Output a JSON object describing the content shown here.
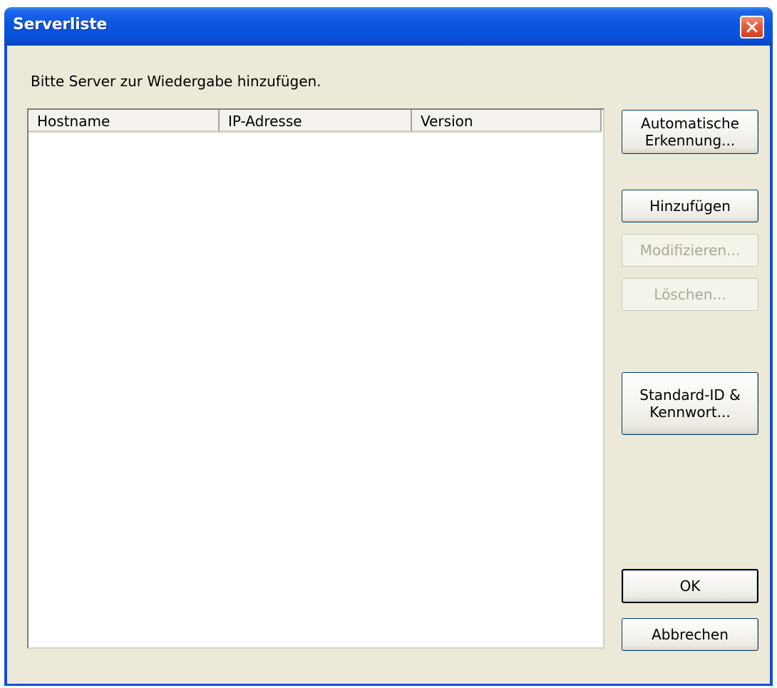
{
  "window": {
    "title": "Serverliste",
    "close_icon": "close-x-icon",
    "colors": {
      "titlebar": "#0a54de",
      "client_bg": "#ece9d8",
      "close_button": "#e35b3a"
    }
  },
  "prompt": "Bitte Server zur Wiedergabe hinzufügen.",
  "table": {
    "columns": [
      "Hostname",
      "IP-Adresse",
      "Version"
    ],
    "rows": []
  },
  "buttons": {
    "auto_detect_line1": "Automatische",
    "auto_detect_line2": "Erkennung...",
    "add": "Hinzufügen",
    "modify": "Modifizieren...",
    "delete": "Löschen...",
    "default_id_line1": "Standard-ID &",
    "default_id_line2": "Kennwort...",
    "ok": "OK",
    "cancel": "Abbrechen"
  },
  "button_states": {
    "modify_enabled": false,
    "delete_enabled": false
  }
}
